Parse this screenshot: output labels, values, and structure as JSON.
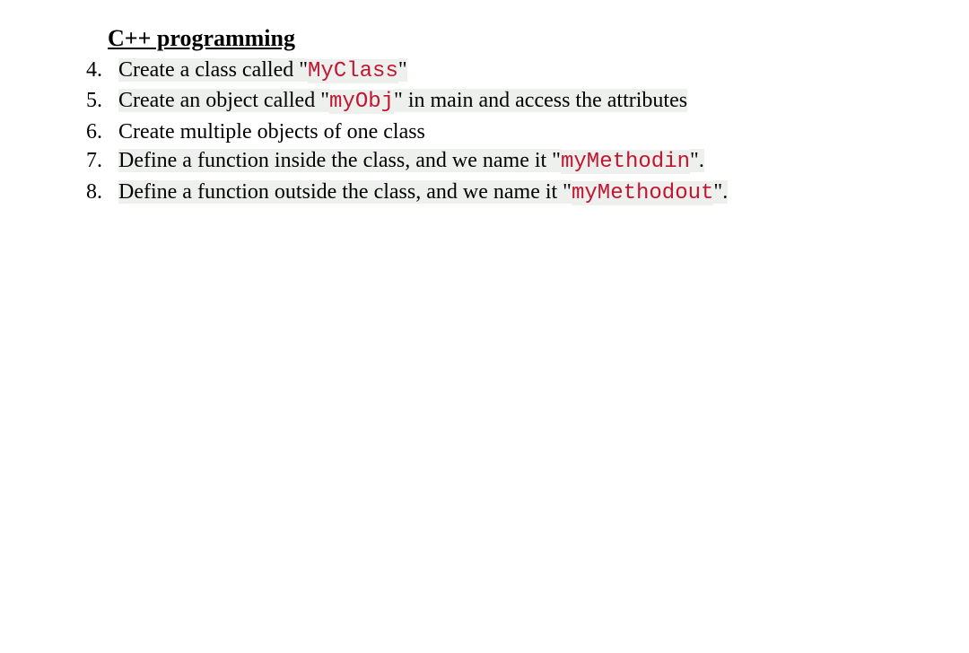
{
  "title": "C++ programming",
  "list_start": 4,
  "items": [
    {
      "parts": [
        {
          "text": "Create a class called \"",
          "cls": "hl"
        },
        {
          "text": "MyClass",
          "cls": "code-red"
        },
        {
          "text": "\"",
          "cls": "hl"
        }
      ]
    },
    {
      "parts": [
        {
          "text": "Create an object called \"",
          "cls": "hl"
        },
        {
          "text": "myObj",
          "cls": "code-red"
        },
        {
          "text": "\"  in main and access the attributes",
          "cls": "hl"
        }
      ]
    },
    {
      "parts": [
        {
          "text": "Create multiple objects of one class",
          "cls": ""
        }
      ]
    },
    {
      "parts": [
        {
          "text": "Define a function inside the class, and we name it \"",
          "cls": "hl"
        },
        {
          "text": "myMethodin",
          "cls": "code-red"
        },
        {
          "text": "\".",
          "cls": "hl"
        }
      ]
    },
    {
      "parts": [
        {
          "text": "Define a function outside the class, and we name it \"",
          "cls": "hl"
        },
        {
          "text": "myMethodout",
          "cls": "code-red"
        },
        {
          "text": "\".",
          "cls": "hl"
        }
      ]
    }
  ]
}
